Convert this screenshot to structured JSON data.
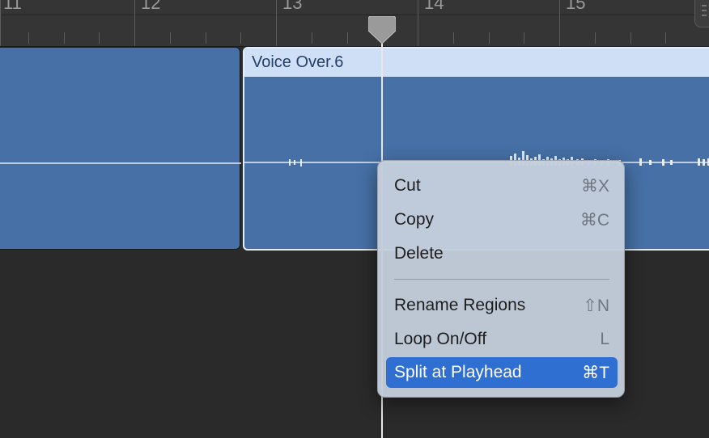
{
  "ruler": {
    "bars": [
      "11",
      "12",
      "13",
      "14",
      "15"
    ]
  },
  "region": {
    "name": "Voice Over.6"
  },
  "context_menu": {
    "items": [
      {
        "label": "Cut",
        "shortcut": "⌘X"
      },
      {
        "label": "Copy",
        "shortcut": "⌘C"
      },
      {
        "label": "Delete",
        "shortcut": ""
      },
      {
        "label": "Rename Regions",
        "shortcut": "⇧N"
      },
      {
        "label": "Loop On/Off",
        "shortcut": "L"
      },
      {
        "label": "Split at Playhead",
        "shortcut": "⌘T"
      }
    ],
    "selected_label": "Split at Playhead"
  },
  "colors": {
    "region_fill": "#4670a6",
    "region_header": "#cfe0f6",
    "menu_highlight": "#2f6fd2",
    "background": "#2b2b2b"
  }
}
